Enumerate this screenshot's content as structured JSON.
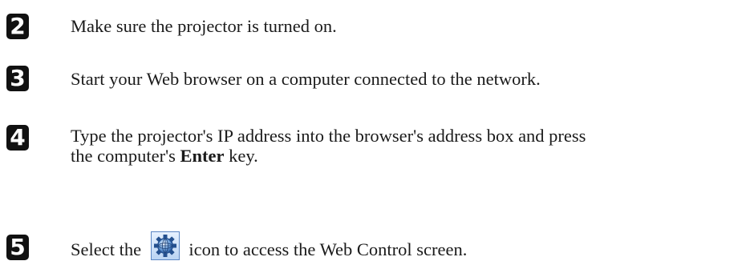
{
  "steps": [
    {
      "number": "2",
      "text": "Make sure the projector is turned on."
    },
    {
      "number": "3",
      "text": "Start your Web browser on a computer connected to the network."
    },
    {
      "number": "4",
      "line1": "Type the projector's IP address into the browser's address box and press",
      "line2_before": "the computer's ",
      "line2_bold": "Enter",
      "line2_after": " key."
    },
    {
      "number": "5",
      "text_before": "Select the",
      "icon": "web-control-gear-globe-icon",
      "text_after": "icon to access the Web Control screen."
    }
  ]
}
